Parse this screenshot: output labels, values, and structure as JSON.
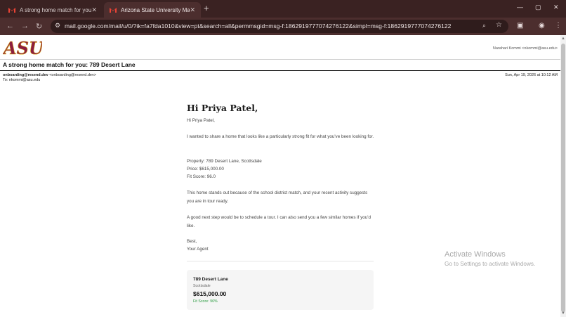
{
  "browser": {
    "tabs": [
      {
        "title": "A strong home match for you:",
        "active": false
      },
      {
        "title": "Arizona State University Mail - /",
        "active": true
      }
    ],
    "url": "mail.google.com/mail/u/0/?ik=fa7fda1010&view=pt&search=all&permmsgid=msg-f:1862919777074276122&simpl=msg-f:1862919777074276122",
    "new_tab": "+",
    "tab_close": "✕",
    "window_controls": {
      "minimize": "—",
      "maximize": "▢",
      "close": "✕"
    }
  },
  "mail": {
    "logo": "ASU",
    "account": "Narahari Kommi <nkommi@asu.edu>",
    "subject": "A strong home match for you: 789 Desert Lane",
    "from_name": "onboarding@resend.dev",
    "from_addr": "<onboarding@resend.dev>",
    "to": "To: nkommi@asu.edu",
    "date": "Sun, Apr 19, 2026 at 10:12 AM"
  },
  "email_body": {
    "greeting": "Hi Priya Patel,",
    "line1": "Hi Priya Patel,",
    "intro": "I wanted to share a home that looks like a particularly strong fit for what you've been looking for.",
    "property": "Property: 789 Desert Lane, Scottsdale",
    "price": "Price: $615,000.00",
    "fit_score": "Fit Score: 96.0",
    "reason": "This home stands out because of the school district match, and your recent activity suggests you are in tour ready.",
    "next_step": "A good next step would be to schedule a tour. I can also send you a few similar homes if you'd like.",
    "signoff": "Best,",
    "signature": "Your Agent"
  },
  "card": {
    "title": "789 Desert Lane",
    "city": "Scottsdale",
    "price": "$615,000.00",
    "fit": "Fit Score: 96%"
  },
  "watermark": {
    "line1": "Activate Windows",
    "line2": "Go to Settings to activate Windows."
  },
  "colors": {
    "chrome_dark": "#3a2222",
    "chrome_toolbar": "#4c2e2e",
    "asu_maroon": "#8c1d40",
    "fit_green": "#2f9e44"
  }
}
